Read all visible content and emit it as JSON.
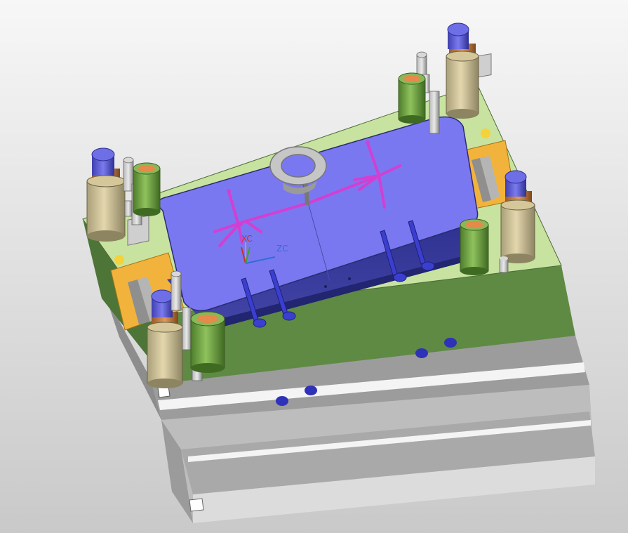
{
  "viewport": {
    "background_top": "#f7f7f7",
    "background_bottom": "#c9c9c9"
  },
  "colors": {
    "plate_green_top": "#c8e3a0",
    "plate_green_side": "#5e8a44",
    "plate_green_side_dark": "#4e7538",
    "core_top": "#7a78f0",
    "core_side": "#3b3d9a",
    "base_gray_light": "#d7d7d7",
    "base_gray_mid": "#b9b9b9",
    "base_gray_dark": "#8f8f8f",
    "stripe_white": "#f4f4f4",
    "orange_block": "#f2b33c",
    "runner_magenta": "#d23fd2",
    "ejector_blue": "#3b3fd0",
    "guide_pin_top": "#5d5dd6",
    "bushing_copper": "#c97a3a",
    "bushing_tan": "#d6c79a",
    "return_pin_green": "#6b9e3e",
    "return_pin_orange": "#e58a4a",
    "axis_x_color": "#cc2d2d",
    "axis_z_color": "#2d6fd6"
  },
  "coordinate_system": {
    "x_label": "XC",
    "z_label": "ZC"
  },
  "icons": {
    "lifting_eye": "lifting-eye-icon",
    "wcs_triad": "wcs-triad-icon"
  }
}
